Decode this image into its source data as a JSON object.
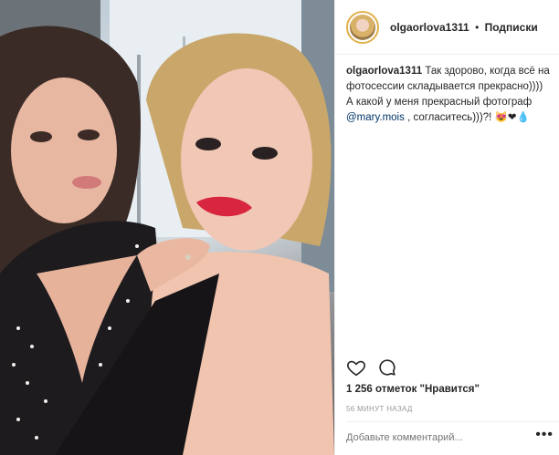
{
  "photo": {
    "description_icon": "selfie-photo"
  },
  "header": {
    "username": "olgaorlova1311",
    "separator": "•",
    "follow_label": "Подписки"
  },
  "caption": {
    "username": "olgaorlova1311",
    "text_before_mention": "Так здорово, когда всё на фотосессии складывается прекрасно)))) А какой у меня прекрасный фотограф ",
    "mention": "@mary.mois",
    "text_after_mention": " , согласитесь)))?! 😻❤💧"
  },
  "actions": {
    "like_icon": "heart-icon",
    "comment_icon": "comment-icon"
  },
  "likes": "1 256 отметок \"Нравится\"",
  "timestamp": "56 МИНУТ НАЗАД",
  "comment_input": {
    "placeholder": "Добавьте комментарий..."
  },
  "more_label": "•••",
  "colors": {
    "accent_link": "#003569",
    "text": "#262626",
    "muted": "#999999",
    "border": "#efefef",
    "avatar_ring": "#e1b04a"
  }
}
